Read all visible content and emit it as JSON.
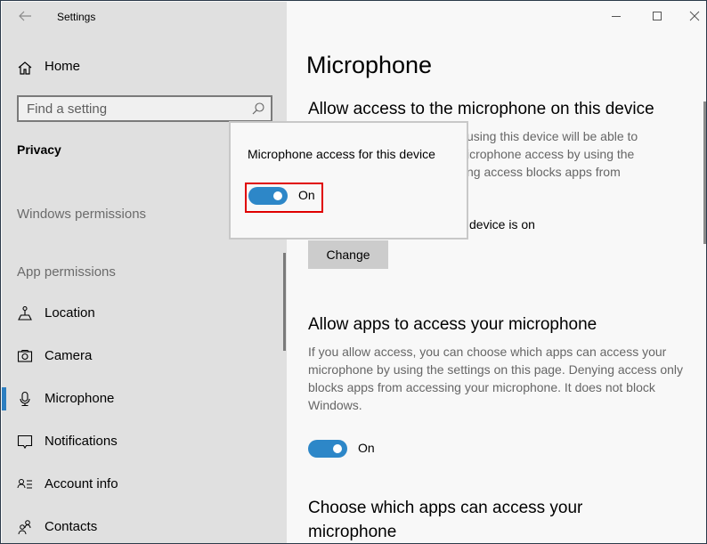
{
  "window": {
    "title": "Settings",
    "controls": {
      "minimize": "minimize-icon",
      "maximize": "maximize-icon",
      "close": "close-icon"
    }
  },
  "sidebar": {
    "back_icon": "arrow-left-icon",
    "home": {
      "label": "Home",
      "icon": "home-icon"
    },
    "search": {
      "placeholder": "Find a setting",
      "value": "",
      "icon": "search-icon"
    },
    "section": "Privacy",
    "groups": [
      {
        "label": "Windows permissions"
      },
      {
        "label": "App permissions"
      }
    ],
    "items": [
      {
        "label": "Location",
        "icon": "location-icon",
        "active": false
      },
      {
        "label": "Camera",
        "icon": "camera-icon",
        "active": false
      },
      {
        "label": "Microphone",
        "icon": "microphone-icon",
        "active": true
      },
      {
        "label": "Notifications",
        "icon": "notifications-icon",
        "active": false
      },
      {
        "label": "Account info",
        "icon": "account-info-icon",
        "active": false
      },
      {
        "label": "Contacts",
        "icon": "contacts-icon",
        "active": false
      }
    ]
  },
  "main": {
    "page_title": "Microphone",
    "section1": {
      "heading": "Allow access to the microphone on this device",
      "description_visible": "using this device will be able to\nicrophone access by using the\nng access blocks apps from",
      "status": "device is on",
      "change_label": "Change"
    },
    "section2": {
      "heading": "Allow apps to access your microphone",
      "description": "If you allow access, you can choose which apps can access your microphone by using the settings on this page. Denying access only blocks apps from accessing your microphone. It does not block Windows.",
      "toggle": {
        "state": "On",
        "checked": true
      }
    },
    "section3": {
      "heading": "Choose which apps can access your microphone"
    }
  },
  "popup": {
    "title": "Microphone access for this device",
    "toggle": {
      "state": "On",
      "checked": true
    },
    "highlight_color": "#e00000"
  },
  "colors": {
    "accent": "#2d87c8",
    "sidebar_bg": "#e0e0e0",
    "content_bg": "#f8f8f8"
  }
}
